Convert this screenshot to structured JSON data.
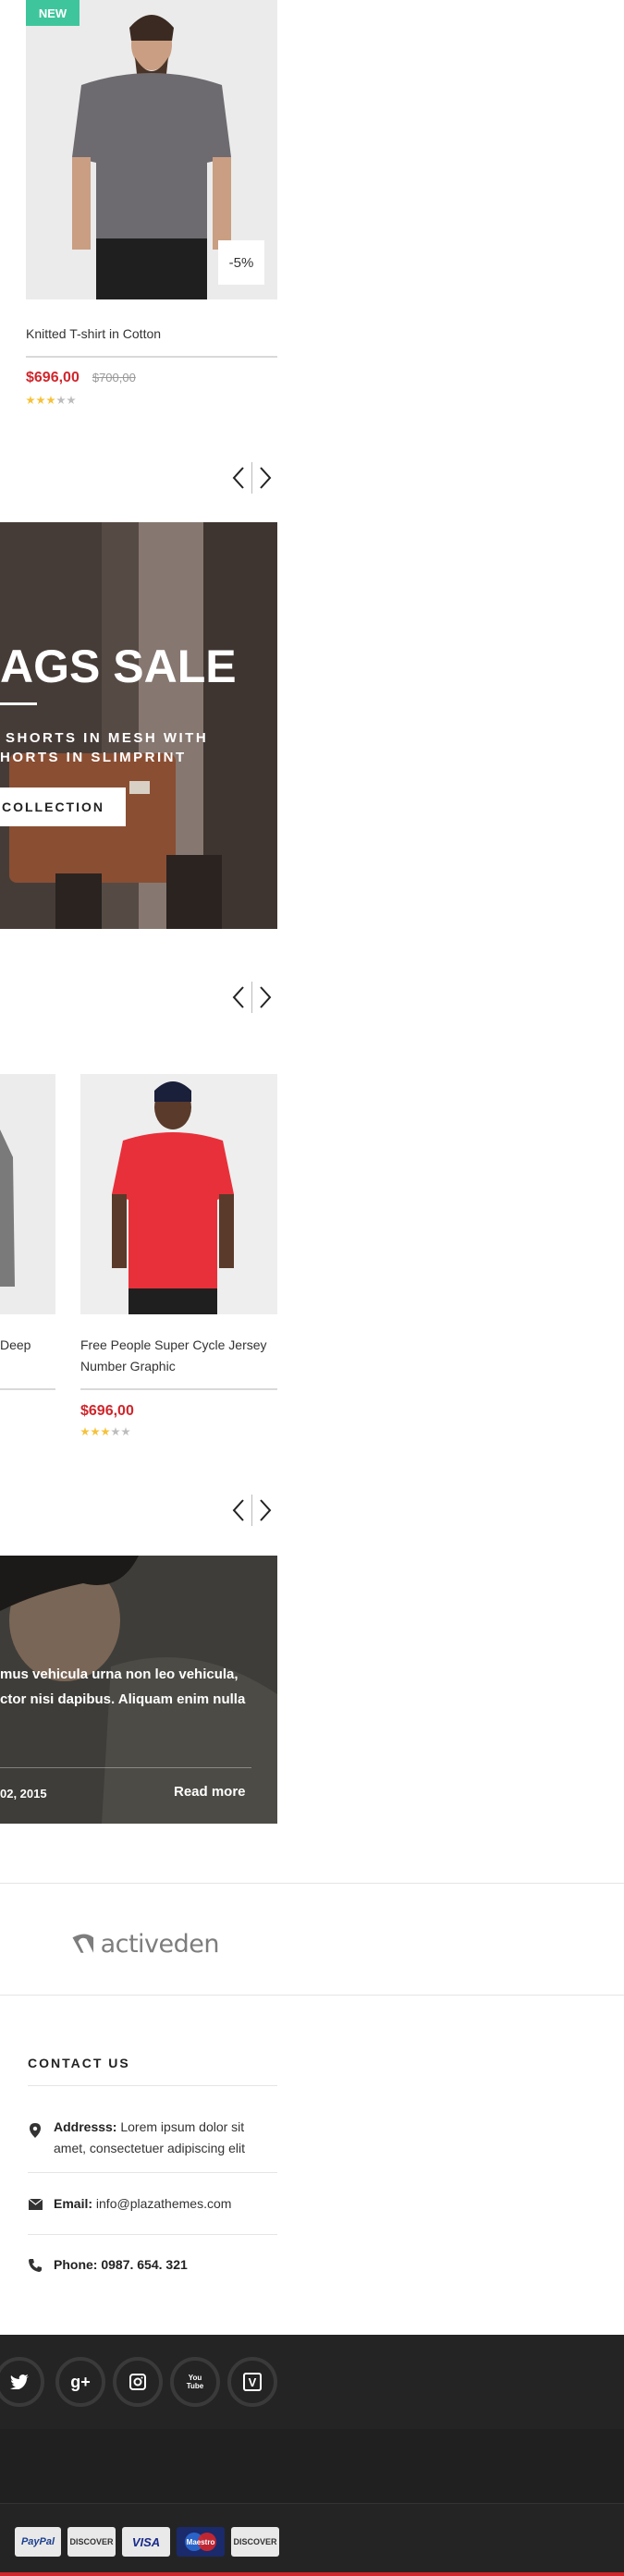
{
  "product1": {
    "badge_new": "NEW",
    "badge_sale": "-5%",
    "name": "Knitted T-shirt in Cotton",
    "price_new": "$696,00",
    "price_old": "$700,00",
    "rating": 3,
    "rating_max": 5
  },
  "banner": {
    "title": "AGS SALE",
    "subtitle_line1": "SHORTS IN MESH WITH",
    "subtitle_line2": "HORTS IN SLIMPRINT",
    "button_label": "COLLECTION"
  },
  "product2": {
    "name_fragment": "Deep"
  },
  "product3": {
    "name_line1": "Free People Super Cycle Jersey",
    "name_line2": "Number Graphic",
    "price_new": "$696,00",
    "rating": 3,
    "rating_max": 5
  },
  "blog": {
    "text_line1": "mus vehicula urna non leo vehicula,",
    "text_line2": "ctor nisi dapibus. Aliquam enim nulla",
    "date": "02, 2015",
    "read_more": "Read more"
  },
  "brand": {
    "name": "activeden"
  },
  "contact": {
    "title": "CONTACT US",
    "address_label": "Addresss:",
    "address_line1": "Lorem ipsum dolor sit",
    "address_line2": "amet, consectetuer adipiscing elit",
    "email_label": "Email:",
    "email_value": "info@plazathemes.com",
    "phone_label": "Phone:",
    "phone_value": "0987. 654. 321"
  },
  "social": {
    "icons": [
      "twitter-icon",
      "google-plus-icon",
      "instagram-icon",
      "youtube-icon",
      "vimeo-icon"
    ],
    "google_plus_glyph": "g+",
    "youtube_glyph": "You Tube",
    "vimeo_glyph": "V"
  },
  "payments": {
    "paypal": "PayPal",
    "discover": "DISCOVER",
    "visa": "VISA",
    "maestro": "Maestro",
    "discover2": "DISCOVER"
  },
  "colors": {
    "accent_red": "#d0262c",
    "badge_green": "#3fc59c",
    "star_gold": "#f5c23a",
    "footer_dark": "#242424"
  }
}
